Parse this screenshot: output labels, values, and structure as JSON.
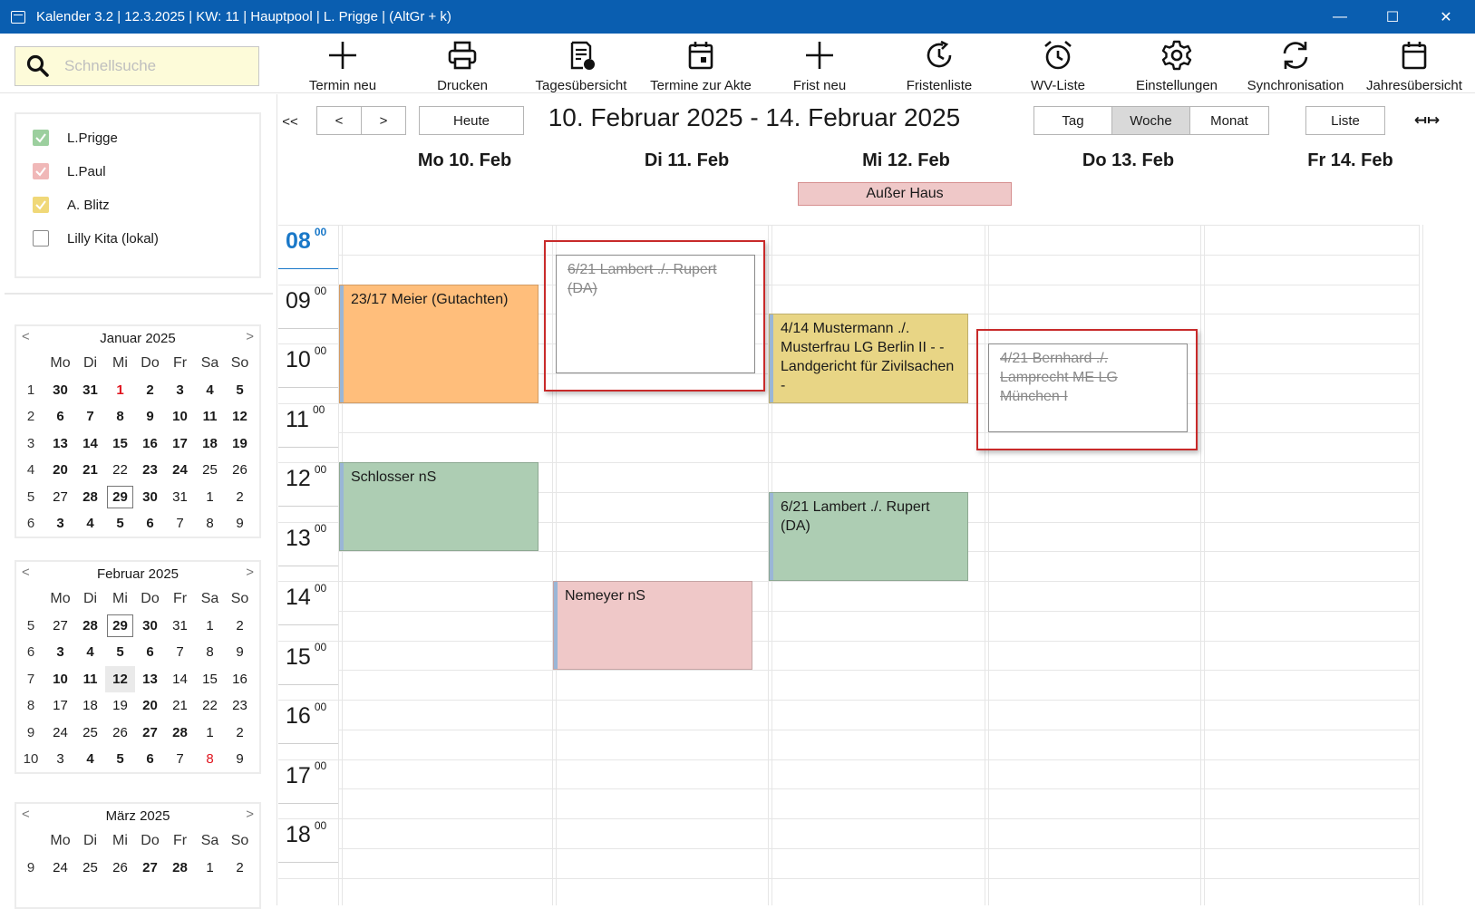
{
  "window": {
    "title": "Kalender 3.2 | 12.3.2025 | KW: 11 | Hauptpool | L. Prigge | (AltGr + k)",
    "minimize": "—",
    "maximize": "☐",
    "close": "✕"
  },
  "search": {
    "placeholder": "Schnellsuche",
    "value": ""
  },
  "toolbar": {
    "buttons": [
      {
        "label": "Termin neu",
        "icon": "plus-icon"
      },
      {
        "label": "Drucken",
        "icon": "printer-icon"
      },
      {
        "label": "Tagesübersicht",
        "icon": "day-overview-icon"
      },
      {
        "label": "Termine zur Akte",
        "icon": "calendar-file-icon"
      },
      {
        "label": "Frist neu",
        "icon": "plus-icon"
      },
      {
        "label": "Fristenliste",
        "icon": "clock-history-icon"
      },
      {
        "label": "WV-Liste",
        "icon": "alarm-clock-icon"
      },
      {
        "label": "Einstellungen",
        "icon": "gear-icon"
      },
      {
        "label": "Synchronisation",
        "icon": "sync-icon"
      },
      {
        "label": "Jahresübersicht",
        "icon": "calendar-icon"
      }
    ]
  },
  "users": [
    {
      "name": "L.Prigge",
      "checked": true,
      "color": "#9ccf9e"
    },
    {
      "name": "L.Paul",
      "checked": true,
      "color": "#f0b8b8"
    },
    {
      "name": "A. Blitz",
      "checked": true,
      "color": "#f0d878"
    },
    {
      "name": "Lilly Kita (lokal)",
      "checked": false,
      "color": "#ffffff"
    }
  ],
  "minicals": [
    {
      "title": "Januar 2025",
      "prev": "<",
      "next": ">",
      "days": [
        "Mo",
        "Di",
        "Mi",
        "Do",
        "Fr",
        "Sa",
        "So"
      ],
      "weeks": [
        {
          "wk": "1",
          "d": [
            "30",
            "31",
            "1",
            "2",
            "3",
            "4",
            "5"
          ]
        },
        {
          "wk": "2",
          "d": [
            "6",
            "7",
            "8",
            "9",
            "10",
            "11",
            "12"
          ]
        },
        {
          "wk": "3",
          "d": [
            "13",
            "14",
            "15",
            "16",
            "17",
            "18",
            "19"
          ]
        },
        {
          "wk": "4",
          "d": [
            "20",
            "21",
            "22",
            "23",
            "24",
            "25",
            "26"
          ]
        },
        {
          "wk": "5",
          "d": [
            "27",
            "28",
            "29",
            "30",
            "31",
            "1",
            "2"
          ]
        },
        {
          "wk": "6",
          "d": [
            "3",
            "4",
            "5",
            "6",
            "7",
            "8",
            "9"
          ]
        }
      ]
    },
    {
      "title": "Februar 2025",
      "prev": "<",
      "next": ">",
      "days": [
        "Mo",
        "Di",
        "Mi",
        "Do",
        "Fr",
        "Sa",
        "So"
      ],
      "weeks": [
        {
          "wk": "5",
          "d": [
            "27",
            "28",
            "29",
            "30",
            "31",
            "1",
            "2"
          ]
        },
        {
          "wk": "6",
          "d": [
            "3",
            "4",
            "5",
            "6",
            "7",
            "8",
            "9"
          ]
        },
        {
          "wk": "7",
          "d": [
            "10",
            "11",
            "12",
            "13",
            "14",
            "15",
            "16"
          ]
        },
        {
          "wk": "8",
          "d": [
            "17",
            "18",
            "19",
            "20",
            "21",
            "22",
            "23"
          ]
        },
        {
          "wk": "9",
          "d": [
            "24",
            "25",
            "26",
            "27",
            "28",
            "1",
            "2"
          ]
        },
        {
          "wk": "10",
          "d": [
            "3",
            "4",
            "5",
            "6",
            "7",
            "8",
            "9"
          ]
        }
      ]
    },
    {
      "title": "März 2025",
      "prev": "<",
      "next": ">",
      "days": [
        "Mo",
        "Di",
        "Mi",
        "Do",
        "Fr",
        "Sa",
        "So"
      ],
      "weeks": [
        {
          "wk": "9",
          "d": [
            "24",
            "25",
            "26",
            "27",
            "28",
            "1",
            "2"
          ]
        }
      ]
    }
  ],
  "nav": {
    "first": "<<",
    "prev": "<",
    "next": ">",
    "today": "Heute",
    "range": "10. Februar 2025 - 14. Februar 2025",
    "views": [
      "Tag",
      "Woche",
      "Monat"
    ],
    "active_view": "Woche",
    "list": "Liste",
    "collapse": "↤↦"
  },
  "days": [
    "Mo 10. Feb",
    "Di 11. Feb",
    "Mi 12. Feb",
    "Do 13. Feb",
    "Fr 14. Feb"
  ],
  "allday": {
    "label": "Außer Haus",
    "day": "Mi 12. Feb"
  },
  "hours": [
    "08",
    "09",
    "10",
    "11",
    "12",
    "13",
    "14",
    "15",
    "16",
    "17",
    "18"
  ],
  "minutes": "00",
  "current_hour": "08",
  "events": [
    {
      "text": "23/17 Meier (Gutachten)",
      "day": "Mo 10. Feb",
      "start": "09:00",
      "end": "11:00",
      "color": "#ffbe7b",
      "struck": false
    },
    {
      "text": "Schlosser nS",
      "day": "Mo 10. Feb",
      "start": "12:00",
      "end": "13:30",
      "color": "#adcdb3",
      "struck": false
    },
    {
      "text": "6/21 Lambert ./. Rupert (DA)",
      "day": "Di 11. Feb",
      "start": "08:30",
      "end": "10:30",
      "color": "#ffffff",
      "struck": true
    },
    {
      "text": "Nemeyer nS",
      "day": "Di 11. Feb",
      "start": "14:00",
      "end": "15:30",
      "color": "#efc8c8",
      "struck": false
    },
    {
      "text": "4/14 Mustermann ./. Musterfrau  LG Berlin II - - Landgericht für Zivilsachen -",
      "day": "Mi 12. Feb",
      "start": "09:30",
      "end": "11:00",
      "color": "#e8d585",
      "struck": false
    },
    {
      "text": "6/21 Lambert ./. Rupert (DA)",
      "day": "Mi 12. Feb",
      "start": "12:30",
      "end": "14:00",
      "color": "#adcdb3",
      "struck": false
    },
    {
      "text": "4/21 Bernhard ./. Lamprecht ME LG München I",
      "day": "Do 13. Feb",
      "start": "10:00",
      "end": "11:30",
      "color": "#ffffff",
      "struck": true
    }
  ]
}
